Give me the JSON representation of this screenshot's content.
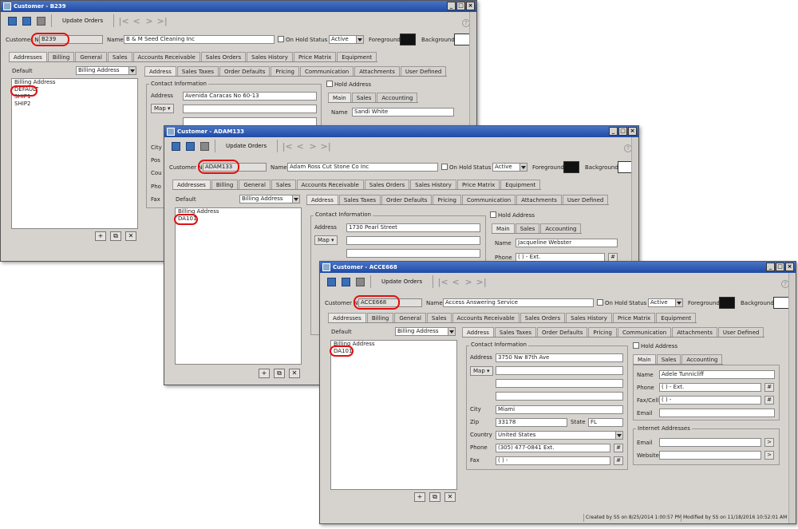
{
  "common": {
    "toolbar_update": "Update Orders",
    "customer_no_label": "Customer No",
    "name_label": "Name",
    "on_hold_label": "On Hold",
    "status_label": "Status",
    "status_value": "Active",
    "foreground_label": "Foreground",
    "background_label": "Background",
    "default_label": "Default",
    "default_value": "Billing Address",
    "contact_info_label": "Contact Information",
    "address_label": "Address",
    "map_label": "Map",
    "hold_address_label": "Hold Address",
    "city_label": "City",
    "zip_label": "Zip",
    "state_label": "State",
    "country_label": "Country",
    "phone_label": "Phone",
    "fax_label": "Fax",
    "name_contact_label": "Name",
    "fax_cell_label": "Fax/Cell",
    "email_label": "Email",
    "internet_label": "Internet Addresses",
    "website_label": "Website",
    "phone_mask": "(   )    -     Ext.",
    "fax_mask": "(   )    -",
    "add_btn": "+",
    "copy_btn": "⧉",
    "del_btn": "✕",
    "sub_tabs": [
      "Main",
      "Sales",
      "Accounting"
    ],
    "main_tabs": [
      "Addresses",
      "Billing",
      "General",
      "Sales",
      "Accounts Receivable",
      "Sales Orders",
      "Sales History",
      "Price Matrix",
      "Equipment"
    ],
    "addr_tabs": [
      "Address",
      "Sales Taxes",
      "Order Defaults",
      "Pricing",
      "Communication",
      "Attachments",
      "User Defined"
    ],
    "help": "?"
  },
  "win1": {
    "title": "Customer - B239",
    "customer_no": "B239",
    "name": "B & M Seed Cleaning Inc",
    "list": [
      "Billing Address",
      "DEFAULT",
      "SHIP1",
      "SHIP2"
    ],
    "address1": "Avenida Caracas No 60-13",
    "contact_name": "Sandi White",
    "partial_labels": [
      "City",
      "Pos",
      "Cou",
      "Pho",
      "Fax"
    ]
  },
  "win2": {
    "title": "Customer - ADAM133",
    "customer_no": "ADAM133",
    "name": "Adam Ross Cut Stone Co Inc",
    "list": [
      "Billing Address",
      "DA101"
    ],
    "address1": "1730 Pearl Street",
    "contact_name": "Jacqueline Webster"
  },
  "win3": {
    "title": "Customer - ACCE668",
    "customer_no": "ACCE668",
    "name": "Access Answering Service",
    "list": [
      "Billing Address",
      "DA101"
    ],
    "address1": "3750 Nw 87th Ave",
    "city": "Miami",
    "zip": "33178",
    "state": "FL",
    "country": "United States",
    "phone": "(305) 477-0841 Ext.",
    "fax": "(  )    -",
    "contact_name": "Adele Tunnicliff",
    "created": "Created by SS on 8/25/2014 1:00:57 PM",
    "modified": "Modified by SS on 11/18/2016 10:52:01 AM"
  }
}
